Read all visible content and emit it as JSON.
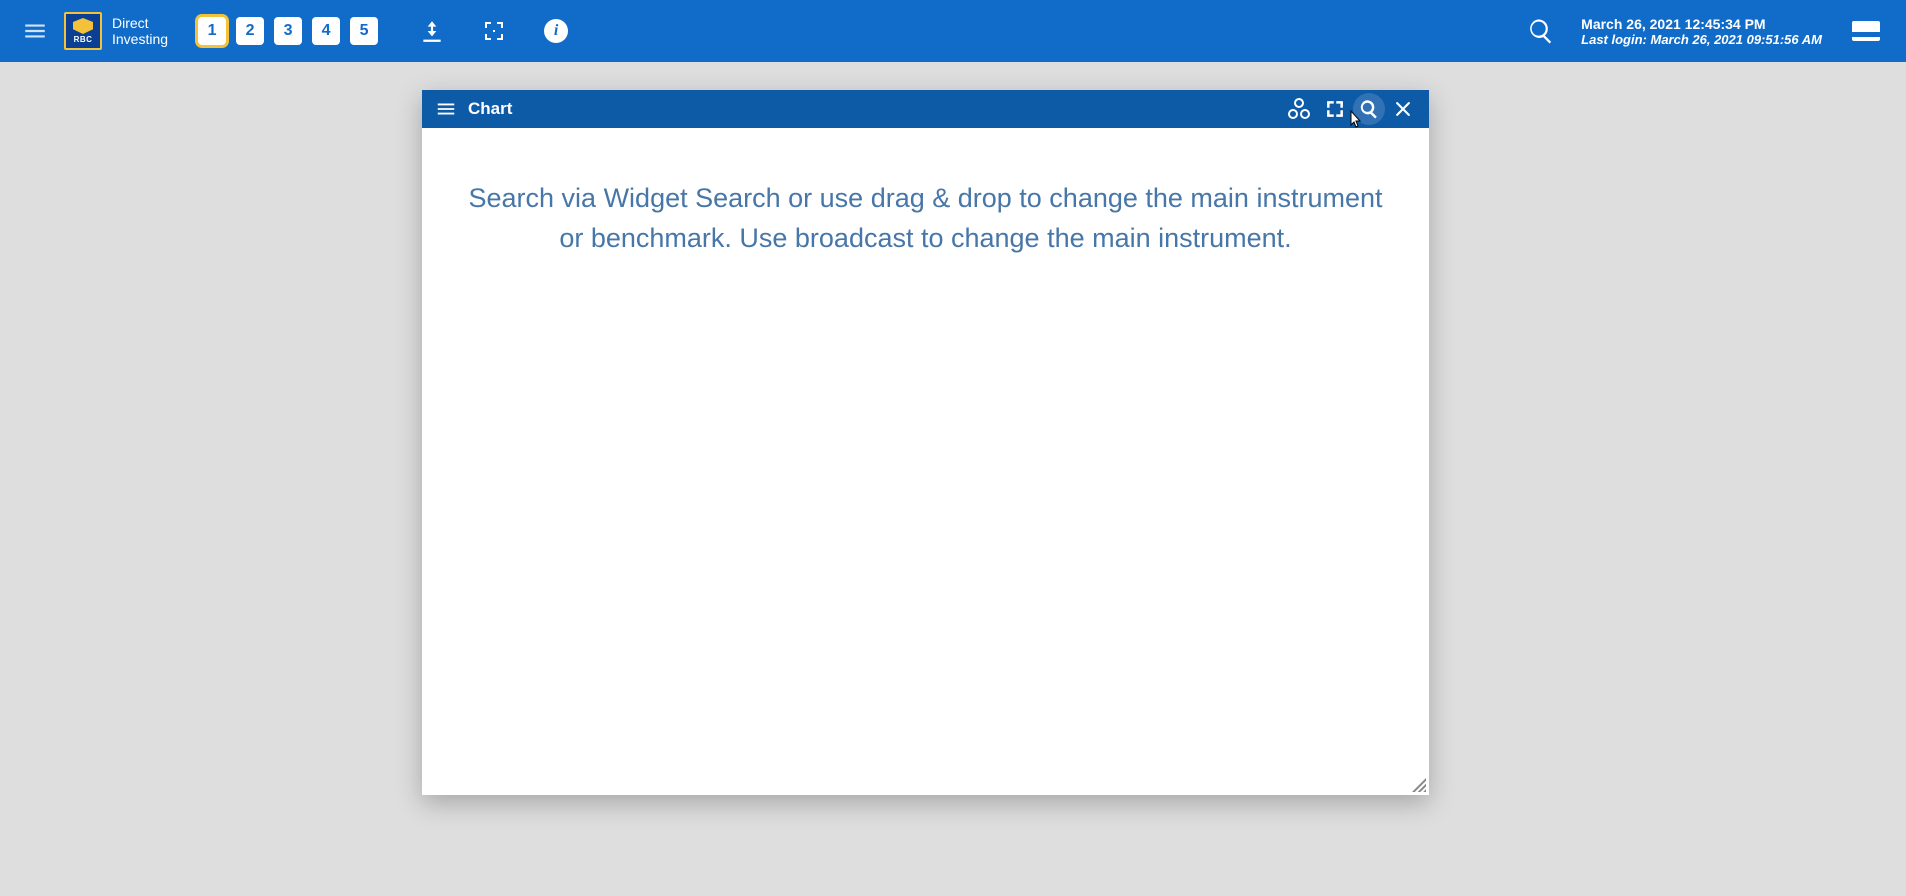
{
  "brand": {
    "logo_text": "RBC",
    "line1": "Direct",
    "line2": "Investing"
  },
  "workspaces": [
    {
      "label": "1",
      "active": true
    },
    {
      "label": "2",
      "active": false
    },
    {
      "label": "3",
      "active": false
    },
    {
      "label": "4",
      "active": false
    },
    {
      "label": "5",
      "active": false
    }
  ],
  "header": {
    "datetime": "March 26, 2021 12:45:34 PM",
    "last_login": "Last login: March 26, 2021 09:51:56 AM"
  },
  "widget": {
    "title": "Chart",
    "placeholder": "Search via Widget Search or use drag & drop to change the main instrument or benchmark. Use broadcast to change the main instrument."
  }
}
